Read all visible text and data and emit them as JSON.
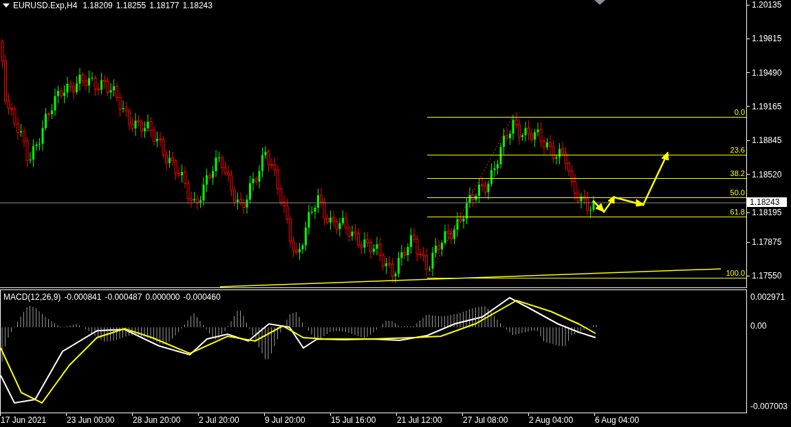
{
  "chart": {
    "symbol": "EURUSD.Exp,H4",
    "quotes": [
      "1.18209",
      "1.18255",
      "1.18177",
      "1.18243"
    ],
    "price_ticks": [
      "1.20135",
      "1.19815",
      "1.19490",
      "1.19165",
      "1.18845",
      "1.18520",
      "1.18195",
      "1.17875",
      "1.17550"
    ],
    "current_price": "1.18243",
    "fibonacci": [
      "0.0",
      "23.6",
      "38.2",
      "50.0",
      "61.8",
      "100.0"
    ]
  },
  "macd": {
    "title": "MACD(12,26,9)",
    "values": [
      "-0.000841",
      "-0.000487",
      "0.000000",
      "-0.000460"
    ],
    "ticks": [
      "0.002971",
      "0.00",
      "-0.007003"
    ]
  },
  "time_axis": [
    "17 Jun 2021",
    "23 Jun 00:00",
    "28 Jun 20:00",
    "2 Jul 20:00",
    "9 Jul 20:00",
    "15 Jul 16:00",
    "21 Jul 12:00",
    "27 Jul 08:00",
    "2 Aug 04:00",
    "6 Aug 04:00"
  ]
}
